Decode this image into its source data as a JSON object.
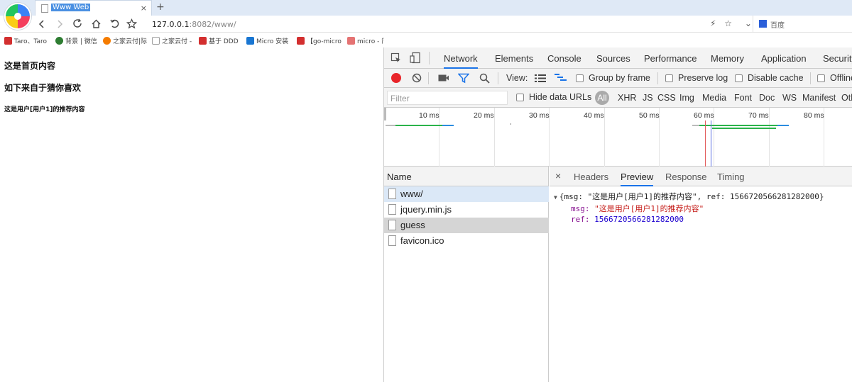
{
  "browser": {
    "tab_title": "Www Web",
    "tab_close": "×",
    "new_tab": "+",
    "url_host": "127.0.0.1",
    "url_path": ":8082/www/",
    "search_engine": "百度"
  },
  "bookmarks": [
    {
      "label": "Taro、Taro",
      "color": "#d32f2f"
    },
    {
      "label": "背景 | 微信",
      "color": "#2e7d32"
    },
    {
      "label": "之家云付|际",
      "color": "#f57c00"
    },
    {
      "label": "之家云付 -",
      "color": "#9e9e9e"
    },
    {
      "label": "基于 DDD",
      "color": "#d32f2f"
    },
    {
      "label": "Micro 安装",
      "color": "#1976d2"
    },
    {
      "label": "【go-micro",
      "color": "#d32f2f"
    },
    {
      "label": "micro - 简",
      "color": "#e57373"
    }
  ],
  "page": {
    "heading1": "这是首页内容",
    "heading2": "如下来自于猜你喜欢",
    "heading3": "这是用户[用户1]的推荐内容"
  },
  "devtools": {
    "tabs": [
      "Network",
      "Elements",
      "Console",
      "Sources",
      "Performance",
      "Memory",
      "Application",
      "Security"
    ],
    "active_tab": "Network",
    "toolbar": {
      "view_label": "View:",
      "group_by_frame": "Group by frame",
      "preserve_log": "Preserve log",
      "disable_cache": "Disable cache",
      "offline": "Offline"
    },
    "filter": {
      "placeholder": "Filter",
      "hide_data_urls": "Hide data URLs",
      "types": [
        "All",
        "XHR",
        "JS",
        "CSS",
        "Img",
        "Media",
        "Font",
        "Doc",
        "WS",
        "Manifest",
        "Other"
      ]
    },
    "timeline": {
      "ticks": [
        "10 ms",
        "20 ms",
        "30 ms",
        "40 ms",
        "50 ms",
        "60 ms",
        "70 ms",
        "80 ms"
      ]
    },
    "requests": {
      "header": "Name",
      "items": [
        "www/",
        "jquery.min.js",
        "guess",
        "favicon.ico"
      ],
      "selected": "guess"
    },
    "detail": {
      "close": "×",
      "tabs": [
        "Headers",
        "Preview",
        "Response",
        "Timing"
      ],
      "active_tab": "Preview",
      "summary": "{msg: \"这是用户[用户1]的推荐内容\", ref: 1566720566281282000}",
      "msg_key": "msg:",
      "msg_value": "\"这是用户[用户1]的推荐内容\"",
      "ref_key": "ref:",
      "ref_value": "1566720566281282000"
    }
  }
}
